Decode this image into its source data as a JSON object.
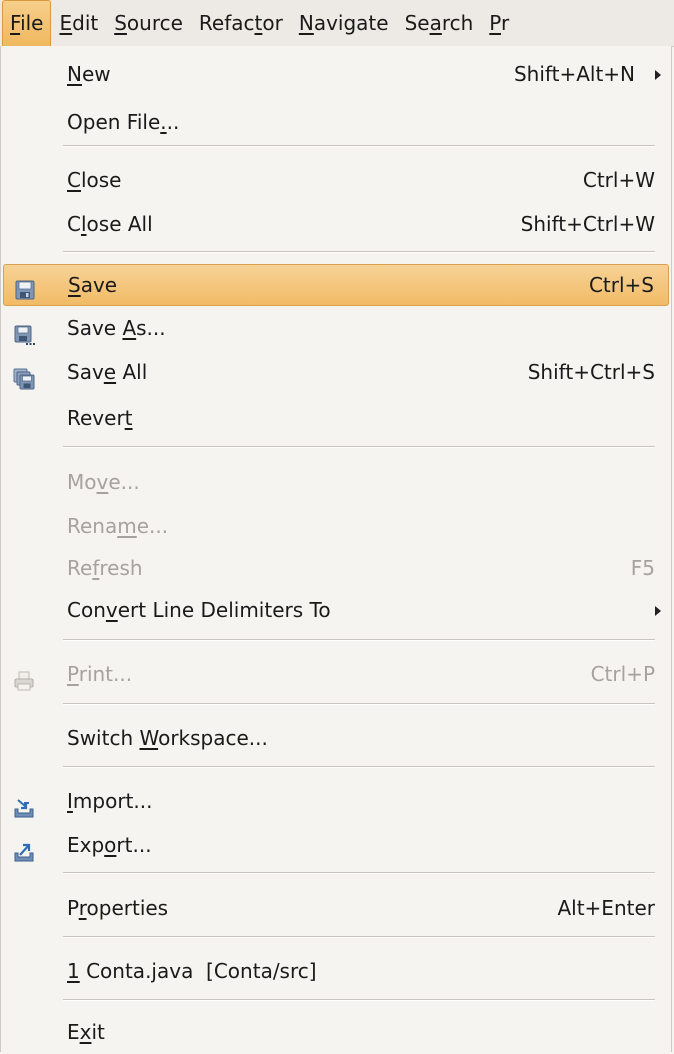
{
  "menubar": {
    "items": [
      {
        "pre": "",
        "mn": "F",
        "post": "ile"
      },
      {
        "pre": "",
        "mn": "E",
        "post": "dit"
      },
      {
        "pre": "",
        "mn": "S",
        "post": "ource"
      },
      {
        "pre": "Refac",
        "mn": "t",
        "post": "or"
      },
      {
        "pre": "",
        "mn": "N",
        "post": "avigate"
      },
      {
        "pre": "Se",
        "mn": "a",
        "post": "rch"
      },
      {
        "pre": "",
        "mn": "P",
        "post": "r"
      }
    ]
  },
  "file_menu": {
    "new": {
      "pre": "",
      "mn": "N",
      "post": "ew",
      "accel": "Shift+Alt+N"
    },
    "open_file": {
      "pre": "Open File",
      "mn": ".",
      "post": "..",
      "accel": ""
    },
    "close": {
      "pre": "",
      "mn": "C",
      "post": "lose",
      "accel": "Ctrl+W"
    },
    "close_all": {
      "pre": "C",
      "mn": "l",
      "post": "ose All",
      "accel": "Shift+Ctrl+W"
    },
    "save": {
      "pre": "",
      "mn": "S",
      "post": "ave",
      "accel": "Ctrl+S"
    },
    "save_as": {
      "pre": "Save ",
      "mn": "A",
      "post": "s...",
      "accel": ""
    },
    "save_all": {
      "pre": "Sav",
      "mn": "e",
      "post": " All",
      "accel": "Shift+Ctrl+S"
    },
    "revert": {
      "pre": "Rever",
      "mn": "t",
      "post": "",
      "accel": ""
    },
    "move": {
      "pre": "Mo",
      "mn": "v",
      "post": "e...",
      "accel": ""
    },
    "rename": {
      "pre": "Rena",
      "mn": "m",
      "post": "e...",
      "accel": ""
    },
    "refresh": {
      "pre": "Re",
      "mn": "f",
      "post": "resh",
      "accel": "F5"
    },
    "convert": {
      "pre": "Con",
      "mn": "v",
      "post": "ert Line Delimiters To",
      "accel": ""
    },
    "print": {
      "pre": "",
      "mn": "P",
      "post": "rint...",
      "accel": "Ctrl+P"
    },
    "switch_workspace": {
      "pre": "Switch ",
      "mn": "W",
      "post": "orkspace...",
      "accel": ""
    },
    "import": {
      "pre": "",
      "mn": "I",
      "post": "mport...",
      "accel": ""
    },
    "export": {
      "pre": "Exp",
      "mn": "o",
      "post": "rt...",
      "accel": ""
    },
    "properties": {
      "pre": "P",
      "mn": "r",
      "post": "operties",
      "accel": "Alt+Enter"
    },
    "recent_1": {
      "pre": "",
      "mn": "1",
      "post": " Conta.java  [Conta/src]",
      "accel": ""
    },
    "exit": {
      "pre": "E",
      "mn": "x",
      "post": "it",
      "accel": ""
    }
  },
  "icons": {
    "save": "floppy-disk-icon",
    "save_as": "floppy-disk-dots-icon",
    "save_all": "multiple-floppy-icon",
    "print": "printer-icon",
    "import": "import-tray-icon",
    "export": "export-tray-icon",
    "submenu": "submenu-arrow-icon"
  },
  "colors": {
    "highlight": "#f1bb66",
    "highlight_border": "#d9a04d",
    "disabled_text": "#a6a29d",
    "menu_bg": "#f6f4f1"
  }
}
